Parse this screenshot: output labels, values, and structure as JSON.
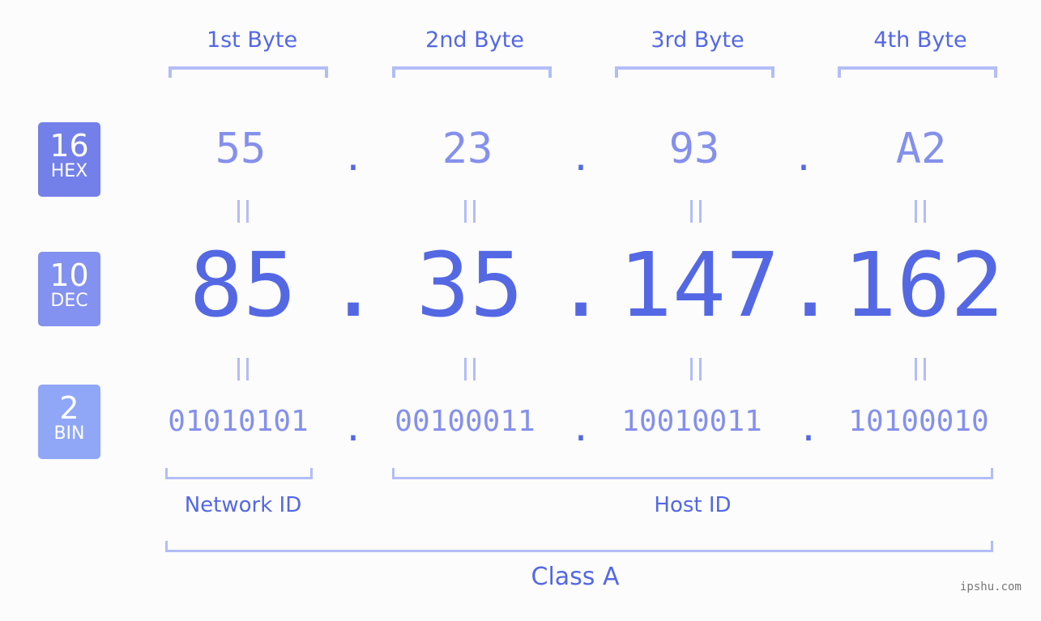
{
  "bytes": [
    {
      "label": "1st Byte",
      "hex": "55",
      "dec": "85",
      "bin": "01010101"
    },
    {
      "label": "2nd Byte",
      "hex": "23",
      "dec": "35",
      "bin": "00100011"
    },
    {
      "label": "3rd Byte",
      "hex": "93",
      "dec": "147",
      "bin": "10010011"
    },
    {
      "label": "4th Byte",
      "hex": "A2",
      "dec": "162",
      "bin": "10100010"
    }
  ],
  "separator": ".",
  "badges": {
    "hex": {
      "num": "16",
      "sub": "HEX",
      "color": "#7380ea"
    },
    "dec": {
      "num": "10",
      "sub": "DEC",
      "color": "#8391f0"
    },
    "bin": {
      "num": "2",
      "sub": "BIN",
      "color": "#90a7f8"
    }
  },
  "labels": {
    "network": "Network ID",
    "host": "Host ID",
    "class": "Class A"
  },
  "watermark": "ipshu.com"
}
